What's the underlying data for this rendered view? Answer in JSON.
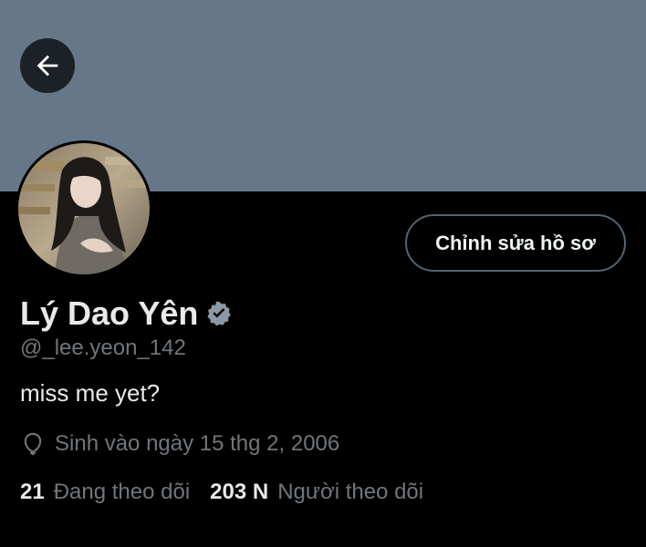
{
  "profile": {
    "display_name": "Lý Dao Yên",
    "handle": "@_lee.yeon_142",
    "bio": "miss me yet?",
    "birthday": "Sinh vào ngày 15 thg 2, 2006",
    "edit_profile_label": "Chỉnh sửa hồ sơ",
    "verified_badge_icon": "verified-badge-icon"
  },
  "stats": {
    "following_count": "21",
    "following_label": "Đang theo dõi",
    "followers_count": "203 N",
    "followers_label": "Người theo dõi"
  },
  "icons": {
    "back": "back-arrow-icon",
    "birthday": "balloon-icon"
  },
  "colors": {
    "banner": "#66778a",
    "background": "#000000",
    "primary_text": "#e7e9ea",
    "secondary_text": "#71767b",
    "button_border": "#536471",
    "back_button_bg": "#1b2126"
  }
}
